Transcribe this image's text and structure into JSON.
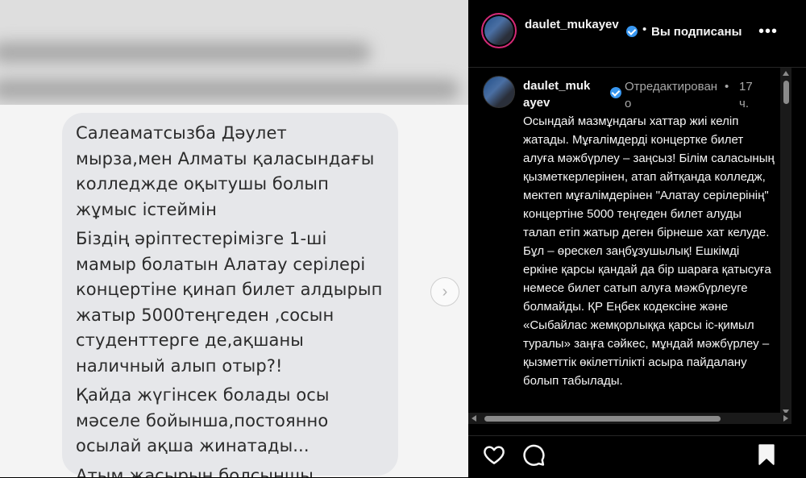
{
  "post": {
    "author": "daulet_mukayev",
    "follow_status": "Вы подписаны",
    "separator": "•"
  },
  "image": {
    "message_paragraphs": [
      "Салеаматсызба Дәулет\nмырза,мен Алматы қаласындағы\nколледжде оқытушы болып\nжұмыс істеймін",
      "Біздің әріптестерімізге 1-ші\nмамыр болатын Алатау серілері\nконцертіне қинап билет алдырып\nжатыр 5000теңгеден ,сосын\nстуденттерге де,ақшаны\nналичный алып отыр?!",
      "Қайда жүгінсек болады осы\nмәселе бойынша,постоянно\nосылай ақша жинатады...",
      "Атым жасырын болсыншы"
    ],
    "next_icon": "chevron-right-icon"
  },
  "comment": {
    "author": "daulet_mukayev",
    "edited_label": "Отредактировано",
    "separator": "•",
    "time": "17 ч.",
    "caption_paragraphs": [
      "Осындай мазмұндағы хаттар жиі келіп жатады. Мұғалімдерді концертке билет алуға мәжбүрлеу – заңсыз! Білім саласының қызметкерлерінен, атап айтқанда колледж, мектеп мұғалімдерінен \"Алатау серілерінің\" концертіне 5000 теңгеден билет алуды талап етіп жатыр деген бірнеше хат келуде.",
      "Бұл – өрескел заңбұзушылық! Ешкімді еркіне қарсы қандай да бір шараға қатысуға немесе билет сатып алуға мәжбүрлеуге болмайды. ҚР Еңбек кодексіне және «Сыбайлас жемқорлыққа қарсы іс-қимыл туралы» заңға сәйкес, мұндай мәжбүрлеу – қызметтік өкілеттілікті асыра пайдалану болып табылады."
    ]
  },
  "actions": {
    "icons": [
      "heart-icon",
      "comment-icon",
      "bookmark-icon"
    ]
  },
  "colors": {
    "panel_bg": "#000000",
    "text": "#f5f5f5",
    "muted": "#a8a8a8",
    "verified": "#3897f0",
    "bubble": "#e6e7ea"
  }
}
